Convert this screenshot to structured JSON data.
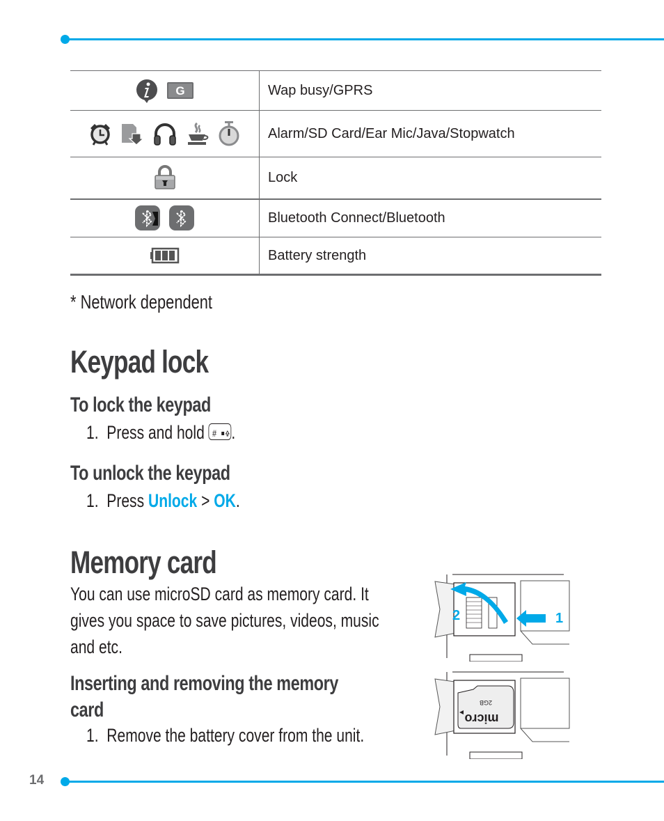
{
  "icon_table": {
    "rows": [
      {
        "icons": [
          "wap-info-icon",
          "gprs-icon"
        ],
        "description": "Wap busy/GPRS",
        "gprs_letter": "G"
      },
      {
        "icons": [
          "alarm-icon",
          "sd-card-icon",
          "headphones-icon",
          "java-icon",
          "stopwatch-icon"
        ],
        "description": "Alarm/SD Card/Ear Mic/Java/Stopwatch"
      },
      {
        "icons": [
          "lock-icon"
        ],
        "description": "Lock"
      },
      {
        "icons": [
          "bluetooth-connect-icon",
          "bluetooth-icon"
        ],
        "description": "Bluetooth Connect/Bluetooth"
      },
      {
        "icons": [
          "battery-icon"
        ],
        "description": "Battery strength"
      }
    ]
  },
  "note": "* Network dependent",
  "keypad_lock": {
    "title": "Keypad lock",
    "lock": {
      "heading": "To lock the keypad",
      "step_number": "1.",
      "step_text": "Press and hold",
      "key_label": "# ",
      "step_end": "."
    },
    "unlock": {
      "heading": "To unlock the keypad",
      "step_number": "1.",
      "step_text": "Press",
      "unlock_label": "Unlock",
      "separator": ">",
      "ok_label": "OK",
      "step_end": "."
    }
  },
  "memory_card": {
    "title": "Memory card",
    "paragraph_lines": [
      "You can use microSD card as memory card. It",
      "gives you space to save pictures, videos, music",
      "and etc."
    ],
    "subheading_lines": [
      "Inserting and removing the memory",
      "card"
    ],
    "step_number": "1.",
    "step_text": "Remove the battery cover from the unit.",
    "illustration_1": {
      "label_1": "1",
      "label_2": "2"
    },
    "illustration_2": {
      "card_brand": "micro",
      "card_capacity": "2GB"
    }
  },
  "footer": {
    "page_number": "14"
  },
  "colors": {
    "accent": "#00a9e8",
    "heading": "#3d3d3f",
    "rule": "#6d6e70"
  }
}
